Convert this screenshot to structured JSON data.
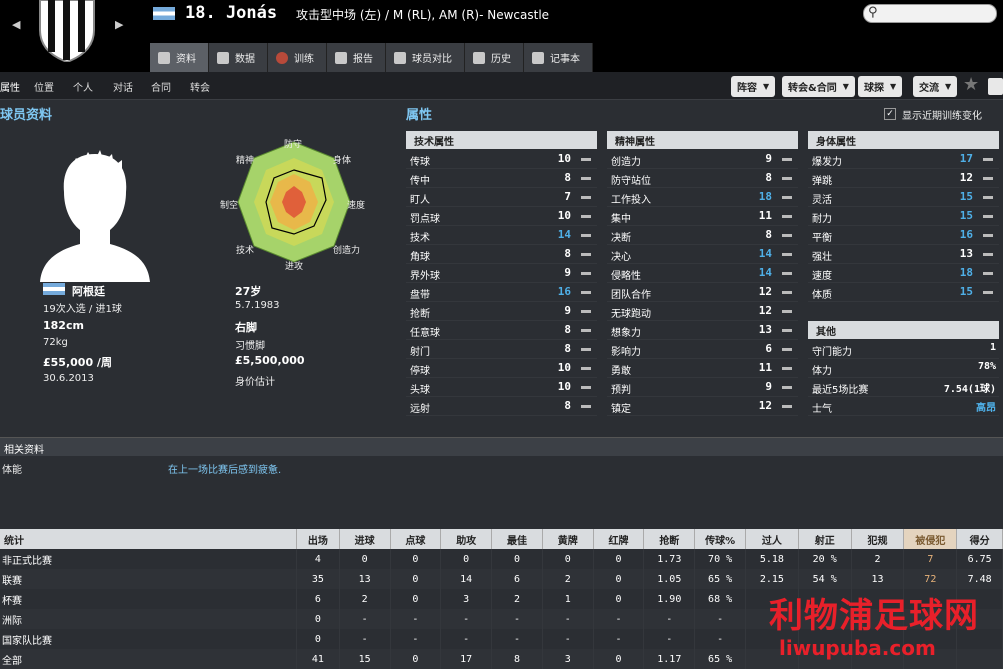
{
  "header": {
    "nav_back": "◀",
    "nav_forward": "▶",
    "title": "18. Jonás",
    "subtitle": "攻击型中场 (左) / M (RL), AM (R)- Newcastle",
    "search_icon": "search-icon"
  },
  "tabs": [
    "资料",
    "数据",
    "训练",
    "报告",
    "球员对比",
    "历史",
    "记事本"
  ],
  "subnav": [
    "属性",
    "位置",
    "个人",
    "对话",
    "合同",
    "转会"
  ],
  "toolbar": {
    "squad": "阵容",
    "transfer": "转会&合同",
    "scout": "球探",
    "interact": "交流"
  },
  "sections": {
    "profile": "球员资料",
    "attributes": "属性",
    "show_training": "显示近期训练变化",
    "related": "相关资料"
  },
  "profile": {
    "nationality": "阿根廷",
    "caps": "19次入选 / 进1球",
    "height": "182cm",
    "weight": "72kg",
    "wage": "£55,000 /周",
    "contract": "30.6.2013",
    "age": "27岁",
    "dob": "5.7.1983",
    "foot": "右脚",
    "foot_label": "习惯脚",
    "value": "£5,500,000",
    "value_label": "身价估计"
  },
  "radar_labels": {
    "top": "防守",
    "top_right": "身体",
    "right": "速度",
    "bottom_right": "创造力",
    "bottom": "进攻",
    "bottom_left": "技术",
    "left": "制空",
    "top_left": "精神"
  },
  "technical": {
    "title": "技术属性",
    "rows": [
      {
        "name": "传球",
        "value": "10"
      },
      {
        "name": "传中",
        "value": "8"
      },
      {
        "name": "盯人",
        "value": "7"
      },
      {
        "name": "罚点球",
        "value": "10"
      },
      {
        "name": "技术",
        "value": "14"
      },
      {
        "name": "角球",
        "value": "8"
      },
      {
        "name": "界外球",
        "value": "9"
      },
      {
        "name": "盘带",
        "value": "16"
      },
      {
        "name": "抢断",
        "value": "9"
      },
      {
        "name": "任意球",
        "value": "8"
      },
      {
        "name": "射门",
        "value": "8"
      },
      {
        "name": "停球",
        "value": "10"
      },
      {
        "name": "头球",
        "value": "10"
      },
      {
        "name": "远射",
        "value": "8"
      }
    ]
  },
  "mental": {
    "title": "精神属性",
    "rows": [
      {
        "name": "创造力",
        "value": "9"
      },
      {
        "name": "防守站位",
        "value": "8"
      },
      {
        "name": "工作投入",
        "value": "18"
      },
      {
        "name": "集中",
        "value": "11"
      },
      {
        "name": "决断",
        "value": "8"
      },
      {
        "name": "决心",
        "value": "14"
      },
      {
        "name": "侵略性",
        "value": "14"
      },
      {
        "name": "团队合作",
        "value": "12"
      },
      {
        "name": "无球跑动",
        "value": "12"
      },
      {
        "name": "想象力",
        "value": "13"
      },
      {
        "name": "影响力",
        "value": "6"
      },
      {
        "name": "勇敢",
        "value": "11"
      },
      {
        "name": "预判",
        "value": "9"
      },
      {
        "name": "镇定",
        "value": "12"
      }
    ]
  },
  "physical": {
    "title": "身体属性",
    "rows": [
      {
        "name": "爆发力",
        "value": "17"
      },
      {
        "name": "弹跳",
        "value": "12"
      },
      {
        "name": "灵活",
        "value": "15"
      },
      {
        "name": "耐力",
        "value": "15"
      },
      {
        "name": "平衡",
        "value": "16"
      },
      {
        "name": "强壮",
        "value": "13"
      },
      {
        "name": "速度",
        "value": "18"
      },
      {
        "name": "体质",
        "value": "15"
      }
    ]
  },
  "other": {
    "title": "其他",
    "rows": [
      {
        "name": "守门能力",
        "value": "1"
      },
      {
        "name": "体力",
        "value": "78%"
      },
      {
        "name": "最近5场比赛",
        "value": "7.54(1球)"
      },
      {
        "name": "士气",
        "value": "高昂"
      }
    ]
  },
  "related": {
    "label": "体能",
    "text": "在上一场比赛后感到疲惫."
  },
  "stats": {
    "headers": [
      "统计",
      "出场",
      "进球",
      "点球",
      "助攻",
      "最佳",
      "黄牌",
      "红牌",
      "抢断",
      "传球%",
      "过人",
      "射正",
      "犯规",
      "被侵犯",
      "得分"
    ],
    "rows": [
      [
        "非正式比赛",
        "4",
        "0",
        "0",
        "0",
        "0",
        "0",
        "0",
        "1.73",
        "70 %",
        "5.18",
        "20 %",
        "2",
        "7",
        "6.75"
      ],
      [
        "联赛",
        "35",
        "13",
        "0",
        "14",
        "6",
        "2",
        "0",
        "1.05",
        "65 %",
        "2.15",
        "54 %",
        "13",
        "72",
        "7.48"
      ],
      [
        "杯赛",
        "6",
        "2",
        "0",
        "3",
        "2",
        "1",
        "0",
        "1.90",
        "68 %",
        "",
        "",
        "",
        "",
        ""
      ],
      [
        "洲际",
        "0",
        "-",
        "-",
        "-",
        "-",
        "-",
        "-",
        "-",
        "-",
        "",
        "",
        "",
        "",
        ""
      ],
      [
        "国家队比赛",
        "0",
        "-",
        "-",
        "-",
        "-",
        "-",
        "-",
        "-",
        "-",
        "",
        "",
        "",
        "",
        ""
      ],
      [
        "全部",
        "41",
        "15",
        "0",
        "17",
        "8",
        "3",
        "0",
        "1.17",
        "65 %",
        "",
        "",
        "",
        "",
        ""
      ]
    ]
  },
  "watermark": {
    "line1": "利物浦足球网",
    "line2": "liwupuba.com"
  },
  "colors": {
    "accent": "#7fc7f2",
    "high_value": "#4fb0e8",
    "normal_value": "#ffffff",
    "fouled": "#e7b27a",
    "watermark": "#e8202a"
  }
}
